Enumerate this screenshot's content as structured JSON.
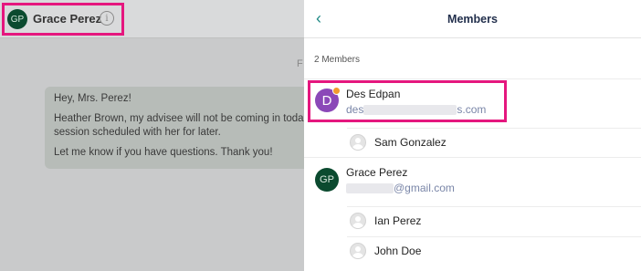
{
  "chat": {
    "header": {
      "avatar_initials": "GP",
      "name": "Grace Perez",
      "info_glyph": "i"
    },
    "date_partial": "F",
    "message": {
      "line1": "Hey, Mrs. Perez!",
      "line2": "Heather Brown, my advisee will not be coming in toda",
      "line3": "session scheduled with her for later.",
      "line4": "Let me know if you have questions. Thank you!"
    }
  },
  "panel": {
    "back_glyph": "‹",
    "title": "Members",
    "members_count": "2 Members",
    "members": [
      {
        "initial": "D",
        "name": "Des Edpan",
        "email_prefix": "des",
        "email_suffix": "s.com",
        "sub_members": [
          {
            "name": "Sam Gonzalez"
          }
        ]
      },
      {
        "initial": "GP",
        "name": "Grace Perez",
        "email_suffix": "@gmail.com",
        "sub_members": [
          {
            "name": "Ian Perez"
          },
          {
            "name": "John Doe"
          }
        ]
      }
    ]
  },
  "colors": {
    "highlight": "#e5177e",
    "accent": "#1f8a86",
    "avatar_d": "#8b48b8",
    "avatar_gp": "#0b4a2f",
    "badge": "#f29a2e"
  }
}
